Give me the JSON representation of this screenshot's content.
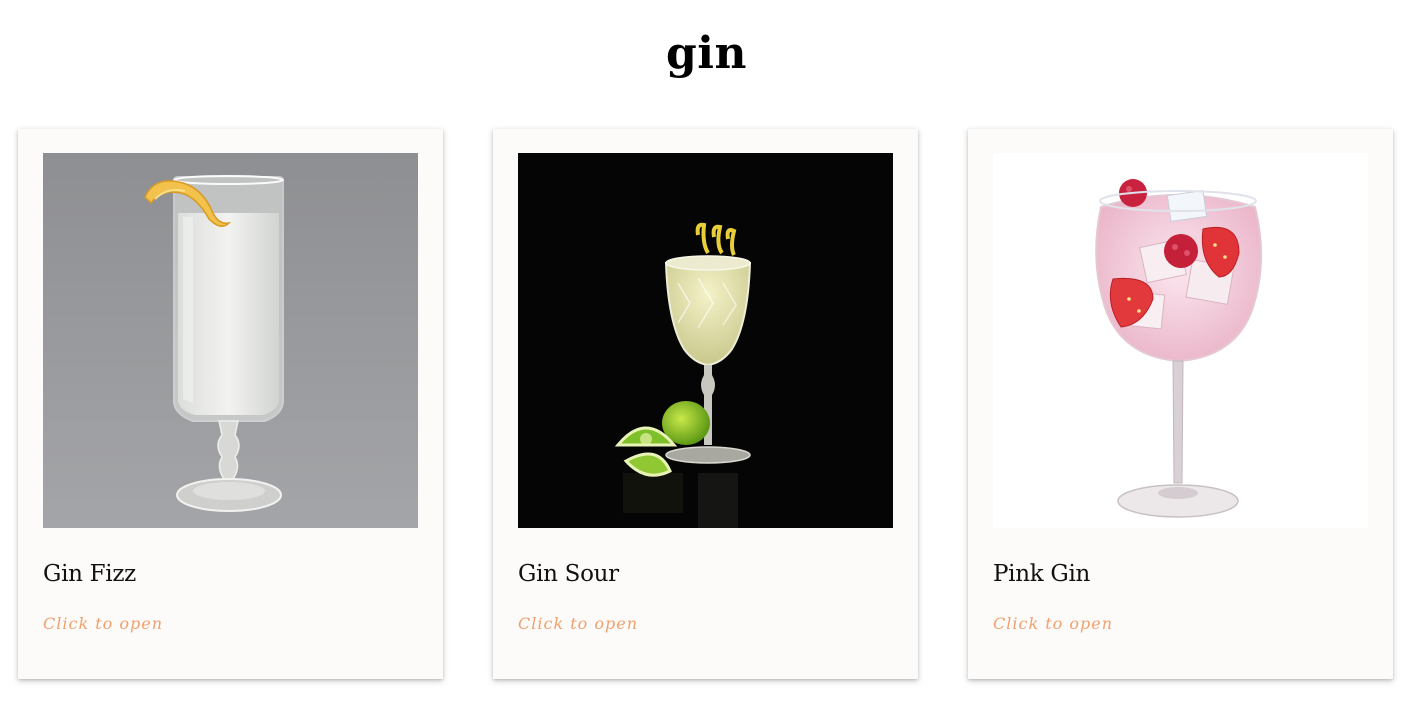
{
  "page": {
    "title": "gin"
  },
  "cards": [
    {
      "title": "Gin Fizz",
      "link_label": "Click to open",
      "image_subject": "gin-fizz-highball-with-lemon-twist"
    },
    {
      "title": "Gin Sour",
      "link_label": "Click to open",
      "image_subject": "gin-sour-goblet-with-lime-wedges"
    },
    {
      "title": "Pink Gin",
      "link_label": "Click to open",
      "image_subject": "pink-gin-balloon-glass-with-berries"
    }
  ],
  "colors": {
    "background": "#ffffff",
    "card_background": "#fdfbf9",
    "link_accent": "#f0a06e",
    "title_text": "#111111"
  }
}
